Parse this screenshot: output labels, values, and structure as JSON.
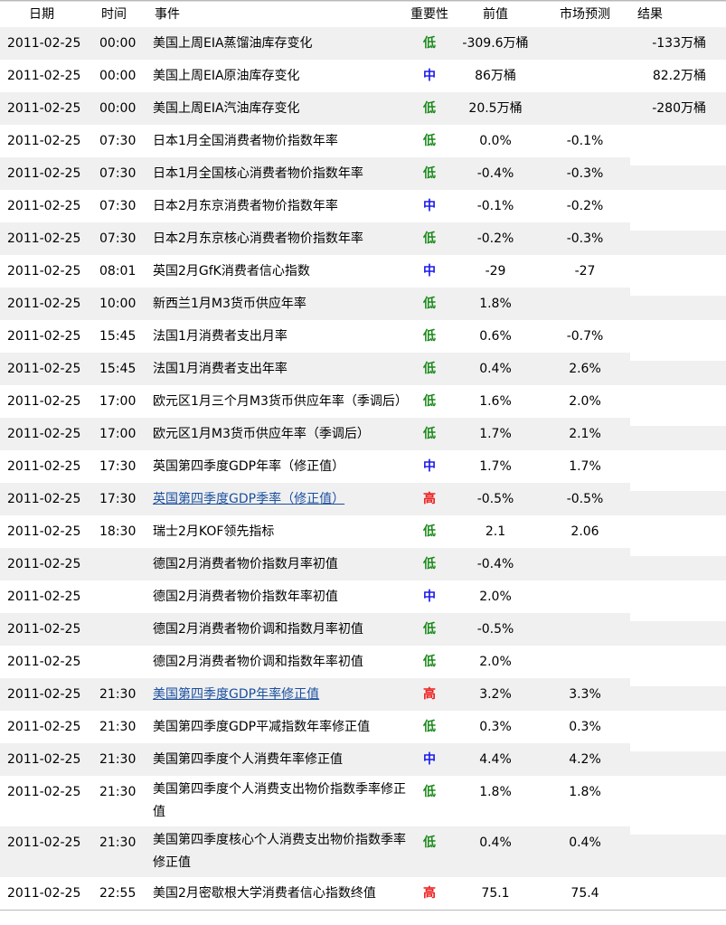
{
  "headers": {
    "date": "日期",
    "time": "时间",
    "event": "事件",
    "importance": "重要性",
    "previous": "前值",
    "forecast": "市场预测",
    "actual": "结果"
  },
  "colors": {
    "low": "#1a8a1a",
    "medium": "#1a1aee",
    "high": "#ee1a1a",
    "link": "#1a4fa0",
    "shade": "#f0f0f0"
  },
  "rows": [
    {
      "date": "2011-02-25",
      "time": "00:00",
      "event": "美国上周EIA蒸馏油库存变化",
      "importance": "低",
      "level": "low",
      "previous": "-309.6万桶",
      "forecast": "",
      "actual": "-133万桶",
      "link": false
    },
    {
      "date": "2011-02-25",
      "time": "00:00",
      "event": "美国上周EIA原油库存变化",
      "importance": "中",
      "level": "medium",
      "previous": "86万桶",
      "forecast": "",
      "actual": "82.2万桶",
      "link": false
    },
    {
      "date": "2011-02-25",
      "time": "00:00",
      "event": "美国上周EIA汽油库存变化",
      "importance": "低",
      "level": "low",
      "previous": "20.5万桶",
      "forecast": "",
      "actual": "-280万桶",
      "link": false
    },
    {
      "date": "2011-02-25",
      "time": "07:30",
      "event": "日本1月全国消费者物价指数年率",
      "importance": "低",
      "level": "low",
      "previous": "0.0%",
      "forecast": "-0.1%",
      "actual": "",
      "link": false
    },
    {
      "date": "2011-02-25",
      "time": "07:30",
      "event": "日本1月全国核心消费者物价指数年率",
      "importance": "低",
      "level": "low",
      "previous": "-0.4%",
      "forecast": "-0.3%",
      "actual": "",
      "link": false
    },
    {
      "date": "2011-02-25",
      "time": "07:30",
      "event": "日本2月东京消费者物价指数年率",
      "importance": "中",
      "level": "medium",
      "previous": "-0.1%",
      "forecast": "-0.2%",
      "actual": "",
      "link": false
    },
    {
      "date": "2011-02-25",
      "time": "07:30",
      "event": "日本2月东京核心消费者物价指数年率",
      "importance": "低",
      "level": "low",
      "previous": "-0.2%",
      "forecast": "-0.3%",
      "actual": "",
      "link": false
    },
    {
      "date": "2011-02-25",
      "time": "08:01",
      "event": "英国2月GfK消费者信心指数",
      "importance": "中",
      "level": "medium",
      "previous": "-29",
      "forecast": "-27",
      "actual": "",
      "link": false
    },
    {
      "date": "2011-02-25",
      "time": "10:00",
      "event": "新西兰1月M3货币供应年率",
      "importance": "低",
      "level": "low",
      "previous": "1.8%",
      "forecast": "",
      "actual": "",
      "link": false
    },
    {
      "date": "2011-02-25",
      "time": "15:45",
      "event": "法国1月消费者支出月率",
      "importance": "低",
      "level": "low",
      "previous": "0.6%",
      "forecast": "-0.7%",
      "actual": "",
      "link": false
    },
    {
      "date": "2011-02-25",
      "time": "15:45",
      "event": "法国1月消费者支出年率",
      "importance": "低",
      "level": "low",
      "previous": "0.4%",
      "forecast": "2.6%",
      "actual": "",
      "link": false
    },
    {
      "date": "2011-02-25",
      "time": "17:00",
      "event": "欧元区1月三个月M3货币供应年率（季调后）",
      "importance": "低",
      "level": "low",
      "previous": "1.6%",
      "forecast": "2.0%",
      "actual": "",
      "link": false
    },
    {
      "date": "2011-02-25",
      "time": "17:00",
      "event": "欧元区1月M3货币供应年率（季调后）",
      "importance": "低",
      "level": "low",
      "previous": "1.7%",
      "forecast": "2.1%",
      "actual": "",
      "link": false
    },
    {
      "date": "2011-02-25",
      "time": "17:30",
      "event": "英国第四季度GDP年率（修正值）",
      "importance": "中",
      "level": "medium",
      "previous": "1.7%",
      "forecast": "1.7%",
      "actual": "",
      "link": false
    },
    {
      "date": "2011-02-25",
      "time": "17:30",
      "event": "英国第四季度GDP季率（修正值）",
      "importance": "高",
      "level": "high",
      "previous": "-0.5%",
      "forecast": "-0.5%",
      "actual": "",
      "link": true
    },
    {
      "date": "2011-02-25",
      "time": "18:30",
      "event": "瑞士2月KOF领先指标",
      "importance": "低",
      "level": "low",
      "previous": "2.1",
      "forecast": "2.06",
      "actual": "",
      "link": false
    },
    {
      "date": "2011-02-25",
      "time": "",
      "event": "德国2月消费者物价指数月率初值",
      "importance": "低",
      "level": "low",
      "previous": "-0.4%",
      "forecast": "",
      "actual": "",
      "link": false
    },
    {
      "date": "2011-02-25",
      "time": "",
      "event": "德国2月消费者物价指数年率初值",
      "importance": "中",
      "level": "medium",
      "previous": "2.0%",
      "forecast": "",
      "actual": "",
      "link": false
    },
    {
      "date": "2011-02-25",
      "time": "",
      "event": "德国2月消费者物价调和指数月率初值",
      "importance": "低",
      "level": "low",
      "previous": "-0.5%",
      "forecast": "",
      "actual": "",
      "link": false
    },
    {
      "date": "2011-02-25",
      "time": "",
      "event": "德国2月消费者物价调和指数年率初值",
      "importance": "低",
      "level": "low",
      "previous": "2.0%",
      "forecast": "",
      "actual": "",
      "link": false
    },
    {
      "date": "2011-02-25",
      "time": "21:30",
      "event": "美国第四季度GDP年率修正值",
      "importance": "高",
      "level": "high",
      "previous": "3.2%",
      "forecast": "3.3%",
      "actual": "",
      "link": true
    },
    {
      "date": "2011-02-25",
      "time": "21:30",
      "event": "美国第四季度GDP平减指数年率修正值",
      "importance": "低",
      "level": "low",
      "previous": "0.3%",
      "forecast": "0.3%",
      "actual": "",
      "link": false
    },
    {
      "date": "2011-02-25",
      "time": "21:30",
      "event": "美国第四季度个人消费年率修正值",
      "importance": "中",
      "level": "medium",
      "previous": "4.4%",
      "forecast": "4.2%",
      "actual": "",
      "link": false
    },
    {
      "date": "2011-02-25",
      "time": "21:30",
      "event": "美国第四季度个人消费支出物价指数季率修正值",
      "importance": "低",
      "level": "low",
      "previous": "1.8%",
      "forecast": "1.8%",
      "actual": "",
      "link": false
    },
    {
      "date": "2011-02-25",
      "time": "21:30",
      "event": "美国第四季度核心个人消费支出物价指数季率修正值",
      "importance": "低",
      "level": "low",
      "previous": "0.4%",
      "forecast": "0.4%",
      "actual": "",
      "link": false
    },
    {
      "date": "2011-02-25",
      "time": "22:55",
      "event": "美国2月密歇根大学消费者信心指数终值",
      "importance": "高",
      "level": "high",
      "previous": "75.1",
      "forecast": "75.4",
      "actual": "",
      "link": false
    }
  ]
}
